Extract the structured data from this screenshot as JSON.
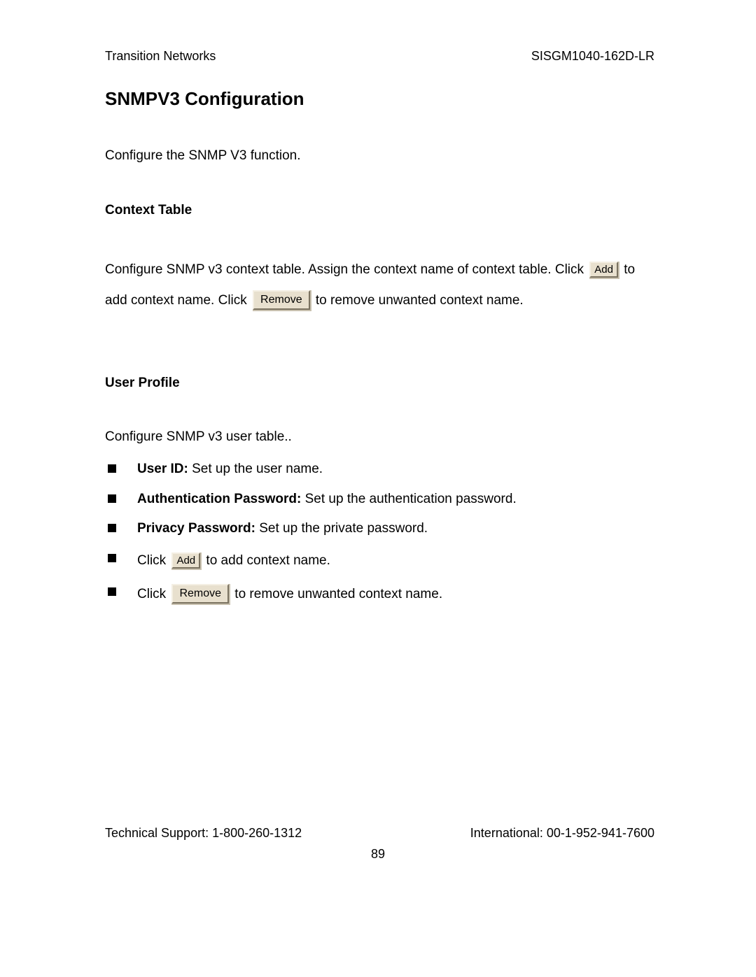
{
  "header": {
    "left": "Transition Networks",
    "right": "SISGM1040-162D-LR"
  },
  "title": "SNMPV3 Configuration",
  "intro": "Configure the SNMP V3 function.",
  "context": {
    "heading": "Context Table",
    "p1_a": "Configure SNMP v3 context table. Assign the context name of context table. Click",
    "add_label": "Add",
    "p1_b": "to add context name. Click",
    "remove_label": "Remove",
    "p1_c": "to remove unwanted context name."
  },
  "user": {
    "heading": "User Profile",
    "intro": "Configure SNMP v3 user table..",
    "items": [
      {
        "label": "User ID:",
        "desc": " Set up the user name."
      },
      {
        "label": "Authentication Password:",
        "desc": " Set up the authentication password."
      },
      {
        "label": "Privacy Password:",
        "desc": " Set up the private password."
      }
    ],
    "click_a_pre": "Click ",
    "click_a_btn": "Add",
    "click_a_post": " to add context name.",
    "click_b_pre": "Click ",
    "click_b_btn": "Remove",
    "click_b_post": " to remove unwanted context name."
  },
  "footer": {
    "left": "Technical Support: 1-800-260-1312",
    "right": "International: 00-1-952-941-7600",
    "page": "89"
  }
}
